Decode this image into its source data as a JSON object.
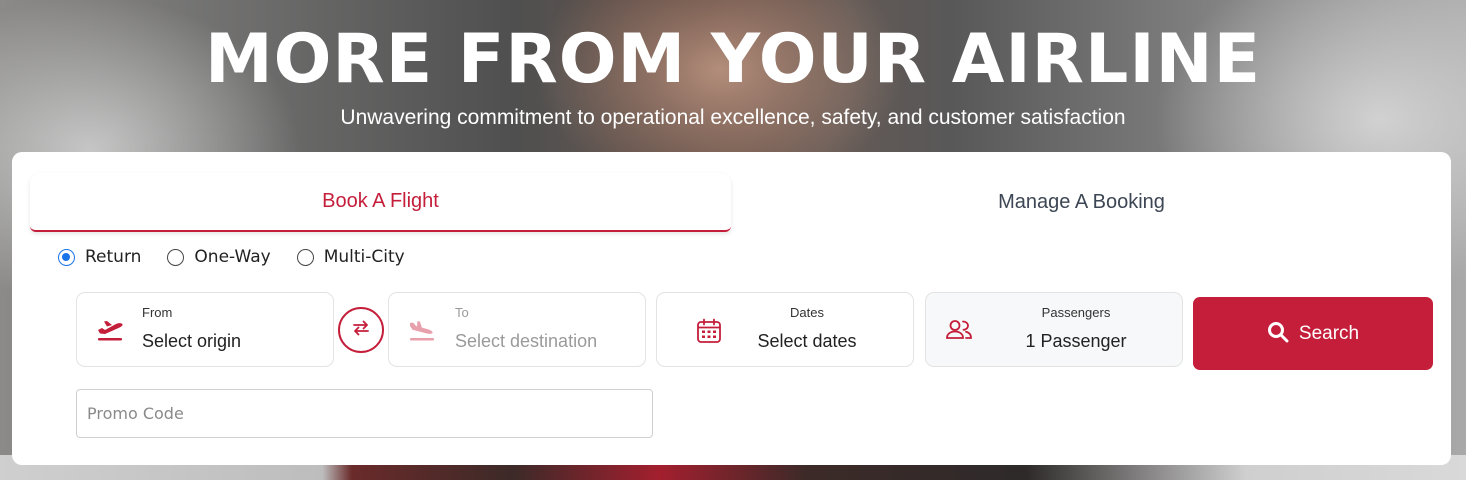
{
  "hero": {
    "title": "MORE FROM YOUR AIRLINE",
    "subtitle": "Unwavering commitment to operational excellence, safety, and customer satisfaction"
  },
  "tabs": [
    {
      "label": "Book A Flight",
      "active": true
    },
    {
      "label": "Manage A Booking",
      "active": false
    }
  ],
  "trip_types": [
    {
      "label": "Return",
      "checked": true
    },
    {
      "label": "One-Way",
      "checked": false
    },
    {
      "label": "Multi-City",
      "checked": false
    }
  ],
  "from": {
    "label": "From",
    "value": "Select origin",
    "icon": "plane-departure-icon"
  },
  "swap": {
    "icon": "swap-arrows-icon"
  },
  "to": {
    "label": "To",
    "value": "Select destination",
    "icon": "plane-arrival-icon"
  },
  "dates": {
    "label": "Dates",
    "value": "Select dates",
    "icon": "calendar-icon"
  },
  "passengers": {
    "label": "Passengers",
    "value": "1 Passenger",
    "icon": "users-icon"
  },
  "search": {
    "label": "Search",
    "icon": "search-icon"
  },
  "promo": {
    "placeholder": "Promo Code",
    "value": ""
  },
  "colors": {
    "accent": "#c41e3a",
    "radio_checked": "#1a73e8",
    "tab_inactive_text": "#3d4654"
  }
}
